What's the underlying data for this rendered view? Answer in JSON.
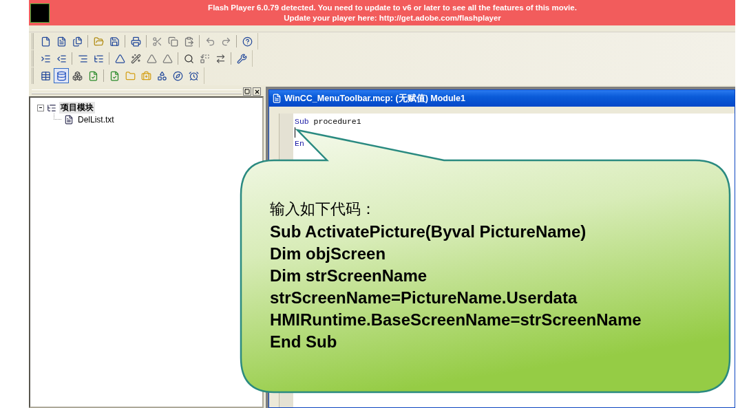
{
  "banner": {
    "lines": [
      "Flash Player 6.0.79 detected. You need to update to v6 or later to see all the features of this movie.",
      "Update your player here: http://get.adobe.com/flashplayer"
    ]
  },
  "project_tree": {
    "items": [
      {
        "label": "项目模块",
        "selected": true,
        "expanded": true,
        "children": [
          {
            "label": "DelList.txt",
            "selected": false
          }
        ]
      }
    ]
  },
  "editor": {
    "title": "WinCC_MenuToolbar.mcp: (无赋值) Module1",
    "lines": [
      {
        "keyword": "Sub",
        "rest": "procedure1"
      },
      {
        "caret": true
      },
      {
        "keyword": "En"
      }
    ]
  },
  "callout": {
    "heading": "输入如下代码：",
    "code_lines": [
      "Sub ActivatePicture(Byval PictureName)",
      "Dim objScreen",
      "Dim strScreenName",
      "strScreenName=PictureName.Userdata",
      "HMIRuntime.BaseScreenName=strScreenName",
      "End Sub"
    ]
  }
}
